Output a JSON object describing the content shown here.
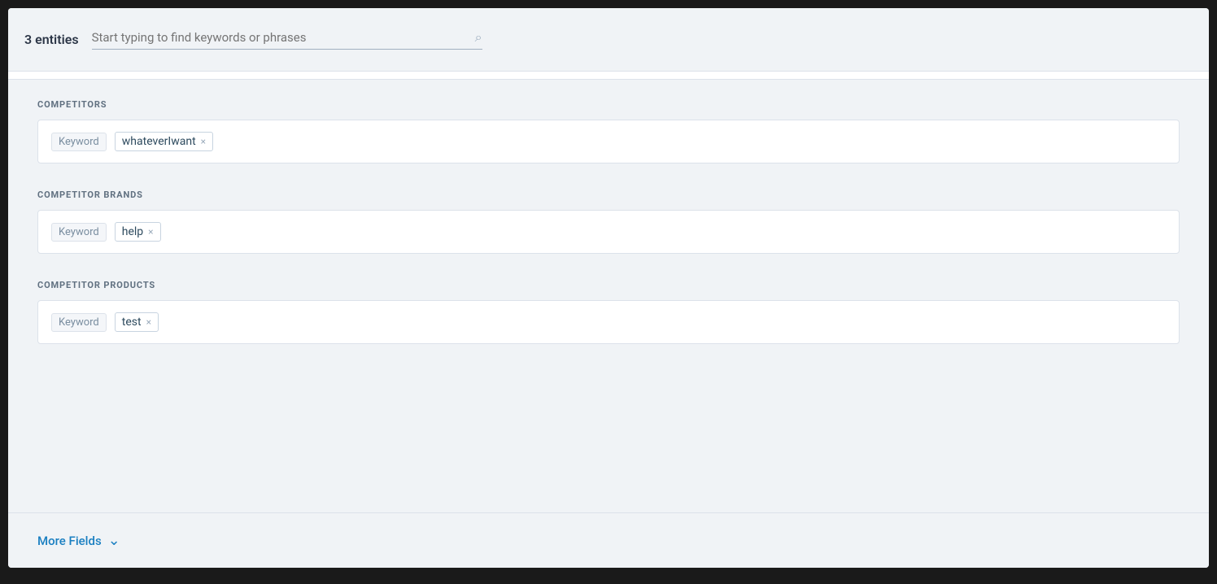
{
  "header": {
    "entity_count": "3 entities",
    "search_placeholder": "Start typing to find keywords or phrases"
  },
  "sections": [
    {
      "id": "competitors",
      "title": "COMPETITORS",
      "keyword_label": "Keyword",
      "tags": [
        {
          "text": "whateverIwant"
        }
      ]
    },
    {
      "id": "competitor_brands",
      "title": "COMPETITOR BRANDS",
      "keyword_label": "Keyword",
      "tags": [
        {
          "text": "help"
        }
      ]
    },
    {
      "id": "competitor_products",
      "title": "COMPETITOR PRODUCTS",
      "keyword_label": "Keyword",
      "tags": [
        {
          "text": "test"
        }
      ]
    }
  ],
  "footer": {
    "more_fields_label": "More Fields"
  },
  "icons": {
    "search": "🔍",
    "close": "×",
    "chevron_down": "⌄"
  }
}
